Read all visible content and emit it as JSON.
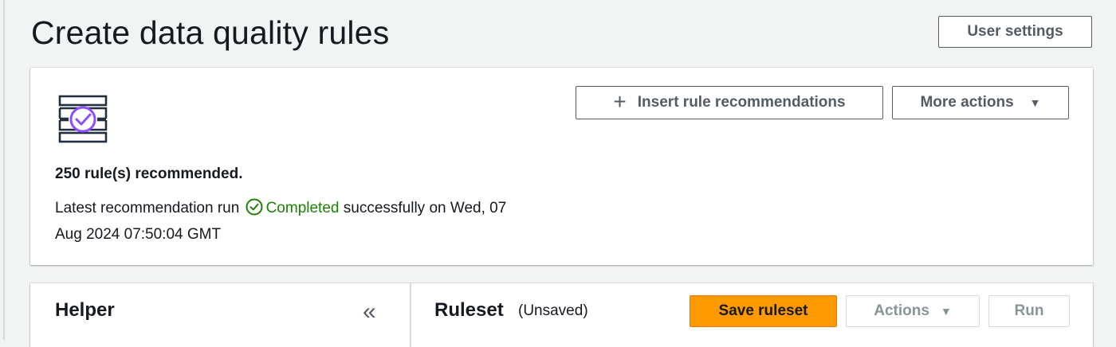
{
  "header": {
    "title": "Create data quality rules",
    "user_settings_label": "User settings"
  },
  "recommendations": {
    "icon": "ruleset-check-icon",
    "insert_label": "Insert rule recommendations",
    "more_actions_label": "More actions",
    "count_text": "250 rule(s) recommended.",
    "status_prefix": "Latest recommendation run",
    "status_value": "Completed",
    "status_suffix": "successfully on Wed, 07",
    "status_date_line2": "Aug 2024 07:50:04 GMT",
    "status_color": "#1d8102",
    "icon_accent_color": "#8c4fff"
  },
  "helper": {
    "title": "Helper",
    "collapse_glyph": "«"
  },
  "ruleset": {
    "title": "Ruleset",
    "state": "(Unsaved)",
    "save_label": "Save ruleset",
    "actions_label": "Actions",
    "run_label": "Run",
    "primary_color": "#ff9900"
  }
}
